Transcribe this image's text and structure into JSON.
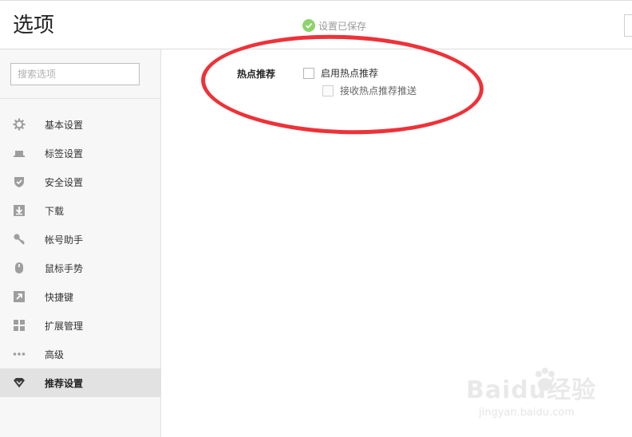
{
  "header": {
    "title": "选项",
    "save_status": "设置已保存",
    "save_status_icon": "check-circle-icon",
    "status_color": "#8cd46a"
  },
  "sidebar": {
    "search_placeholder": "搜索选项",
    "items": [
      {
        "label": "基本设置",
        "icon": "gear-icon",
        "active": false
      },
      {
        "label": "标签设置",
        "icon": "tab-icon",
        "active": false
      },
      {
        "label": "安全设置",
        "icon": "shield-icon",
        "active": false
      },
      {
        "label": "下载",
        "icon": "download-icon",
        "active": false
      },
      {
        "label": "帐号助手",
        "icon": "key-icon",
        "active": false
      },
      {
        "label": "鼠标手势",
        "icon": "mouse-icon",
        "active": false
      },
      {
        "label": "快捷键",
        "icon": "shortcut-arrow-icon",
        "active": false
      },
      {
        "label": "扩展管理",
        "icon": "extensions-grid-icon",
        "active": false
      },
      {
        "label": "高级",
        "icon": "more-dots-icon",
        "active": false
      },
      {
        "label": "推荐设置",
        "icon": "diamond-icon",
        "active": true
      }
    ]
  },
  "content": {
    "section_label": "热点推荐",
    "options": [
      {
        "label": "启用热点推荐",
        "checked": false,
        "enabled": true
      },
      {
        "label": "接收热点推荐推送",
        "checked": false,
        "enabled": false
      }
    ]
  },
  "annotation": {
    "color": "#ee3238"
  },
  "watermark": {
    "brand": "Baidu经验",
    "url": "jingyan.baidu.com"
  }
}
